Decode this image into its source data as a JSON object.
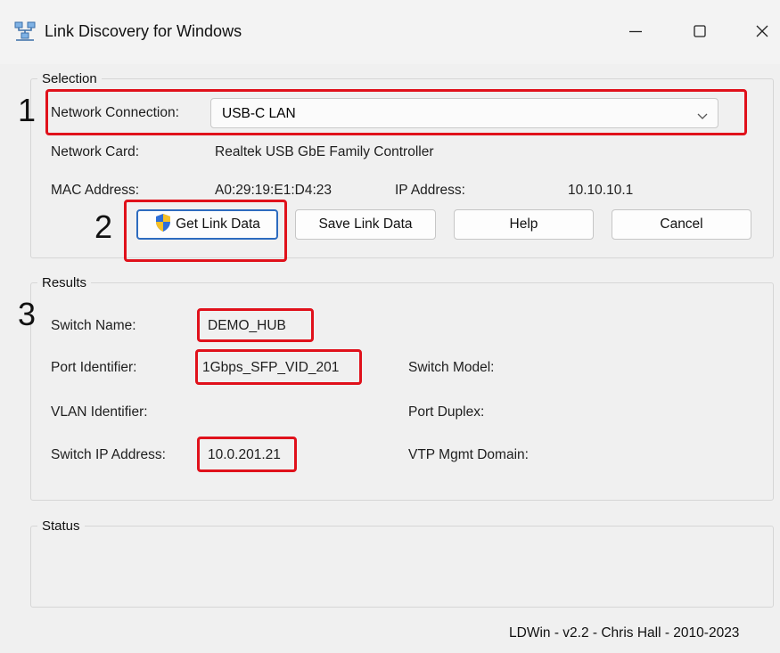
{
  "window": {
    "title": "Link Discovery for Windows",
    "icons": {
      "app": "network-icon",
      "minimize": "minimize-icon",
      "maximize": "maximize-icon",
      "close": "close-icon"
    }
  },
  "selection": {
    "group_label": "Selection",
    "network_connection_label": "Network Connection:",
    "network_connection_value": "USB-C LAN",
    "network_card_label": "Network Card:",
    "network_card_value": "Realtek USB GbE Family Controller",
    "mac_label": "MAC Address:",
    "mac_value": "A0:29:19:E1:D4:23",
    "ip_label": "IP Address:",
    "ip_value": "10.10.10.1"
  },
  "buttons": {
    "get_link_data": "Get Link Data",
    "save_link_data": "Save Link Data",
    "help": "Help",
    "cancel": "Cancel"
  },
  "results": {
    "group_label": "Results",
    "switch_name_label": "Switch Name:",
    "switch_name_value": "DEMO_HUB",
    "port_identifier_label": "Port Identifier:",
    "port_identifier_value": "1Gbps_SFP_VID_201",
    "switch_model_label": "Switch Model:",
    "vlan_identifier_label": "VLAN Identifier:",
    "port_duplex_label": "Port Duplex:",
    "switch_ip_label": "Switch IP Address:",
    "switch_ip_value": "10.0.201.21",
    "vtp_label": "VTP Mgmt Domain:"
  },
  "status": {
    "group_label": "Status"
  },
  "annotations": {
    "callout_1": "1",
    "callout_2": "2",
    "callout_3": "3",
    "highlight_color": "#e0111b"
  },
  "footer": "LDWin - v2.2 - Chris Hall - 2010-2023"
}
